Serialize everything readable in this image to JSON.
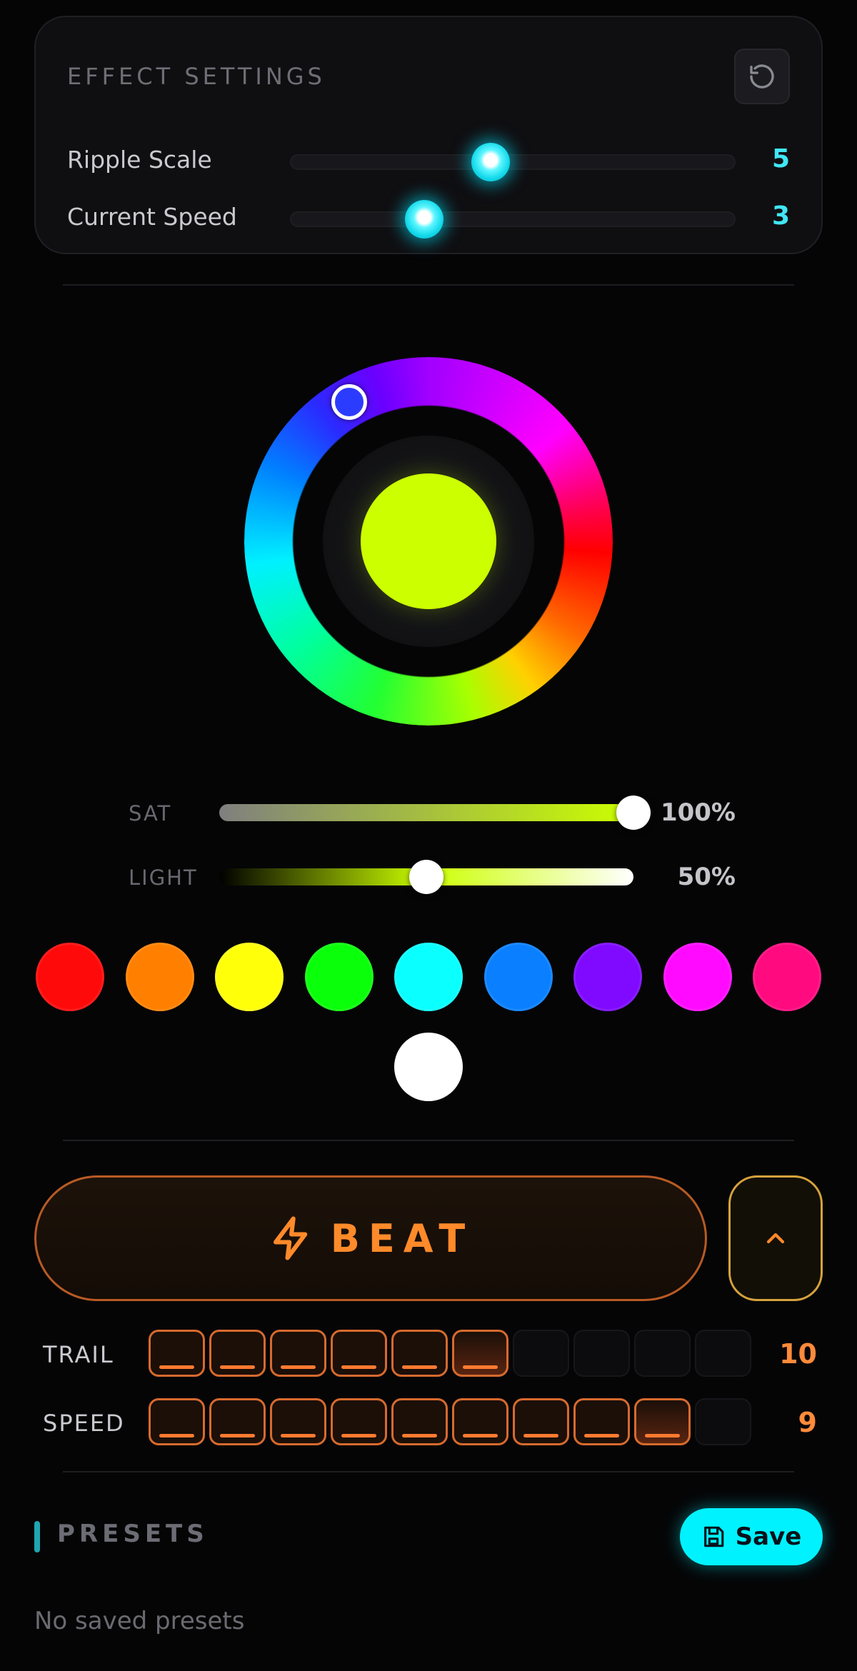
{
  "effect_settings": {
    "title": "EFFECT SETTINGS",
    "reset_icon": "reset-icon",
    "params": [
      {
        "label": "Ripple Scale",
        "value": "5",
        "level": 0.45
      },
      {
        "label": "Current Speed",
        "value": "3",
        "level": 0.3
      }
    ],
    "accent_color": "#41e6f4"
  },
  "color_picker": {
    "selected_color": "#ccff00",
    "handle_color": "#2c3cff",
    "sat": {
      "label": "SAT",
      "value": "100%",
      "level": 1.0
    },
    "light": {
      "label": "LIGHT",
      "value": "50%",
      "level": 0.5
    }
  },
  "swatches": [
    "#ff0a0a",
    "#ff8000",
    "#ffff0a",
    "#0aff0a",
    "#0affff",
    "#0a7fff",
    "#7f0aff",
    "#ff0aff",
    "#ff0a7f",
    "#ffffff"
  ],
  "beat": {
    "label": "BEAT",
    "icon": "lightning-icon",
    "expand_icon": "chevron-up-icon",
    "accent_color": "#ff8a2a"
  },
  "trail": {
    "label": "TRAIL",
    "value": "10",
    "active": 6,
    "total": 10
  },
  "speed": {
    "label": "SPEED",
    "value": "9",
    "active": 9,
    "total": 10
  },
  "presets": {
    "title": "PRESETS",
    "save_label": "Save",
    "save_icon": "floppy-disk-icon",
    "empty_text": "No saved presets"
  }
}
